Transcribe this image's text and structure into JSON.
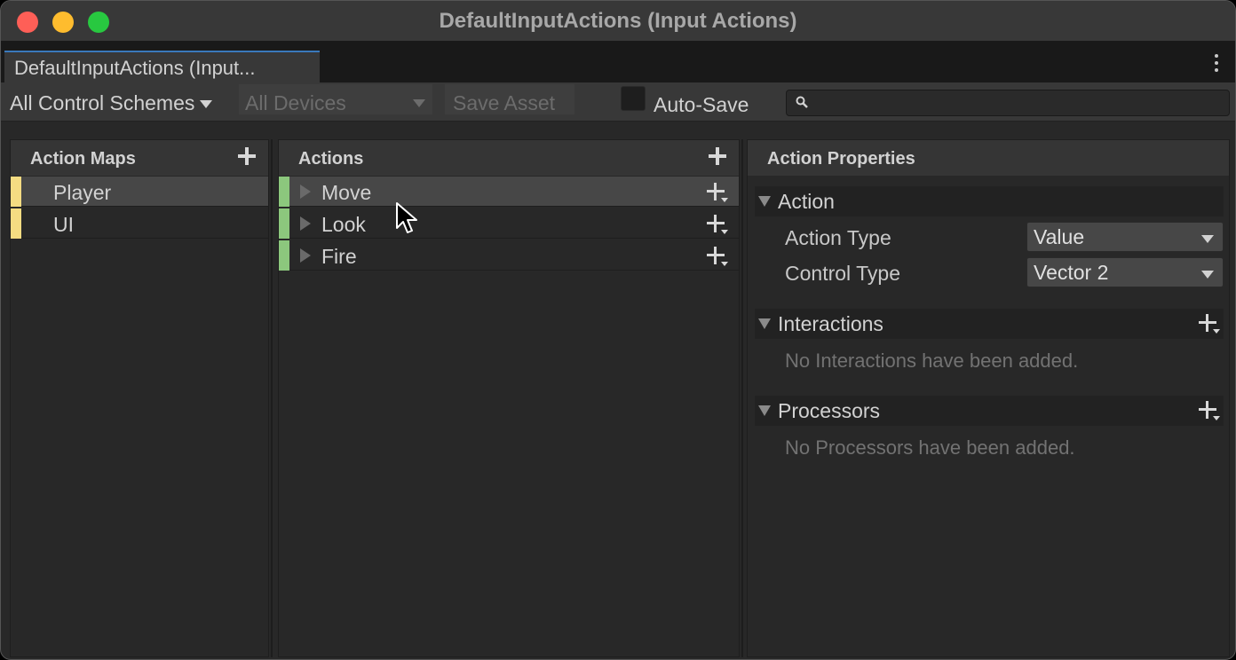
{
  "window": {
    "title": "DefaultInputActions (Input Actions)"
  },
  "tab": {
    "label": "DefaultInputActions (Input..."
  },
  "toolbar": {
    "control_scheme": "All Control Schemes",
    "devices": "All Devices",
    "save_asset": "Save Asset",
    "auto_save_label": "Auto-Save",
    "auto_save_checked": false,
    "search_value": ""
  },
  "action_maps": {
    "header": "Action Maps",
    "items": [
      {
        "label": "Player",
        "selected": true
      },
      {
        "label": "UI",
        "selected": false
      }
    ]
  },
  "actions": {
    "header": "Actions",
    "items": [
      {
        "label": "Move",
        "selected": true
      },
      {
        "label": "Look",
        "selected": false
      },
      {
        "label": "Fire",
        "selected": false
      }
    ]
  },
  "properties": {
    "header": "Action Properties",
    "action_section": "Action",
    "action_type_label": "Action Type",
    "action_type_value": "Value",
    "control_type_label": "Control Type",
    "control_type_value": "Vector 2",
    "interactions_section": "Interactions",
    "interactions_empty": "No Interactions have been added.",
    "processors_section": "Processors",
    "processors_empty": "No Processors have been added."
  },
  "colors": {
    "map_stripe": "#f4dc82",
    "action_stripe": "#8cc77d",
    "tab_accent": "#3a79bb"
  }
}
